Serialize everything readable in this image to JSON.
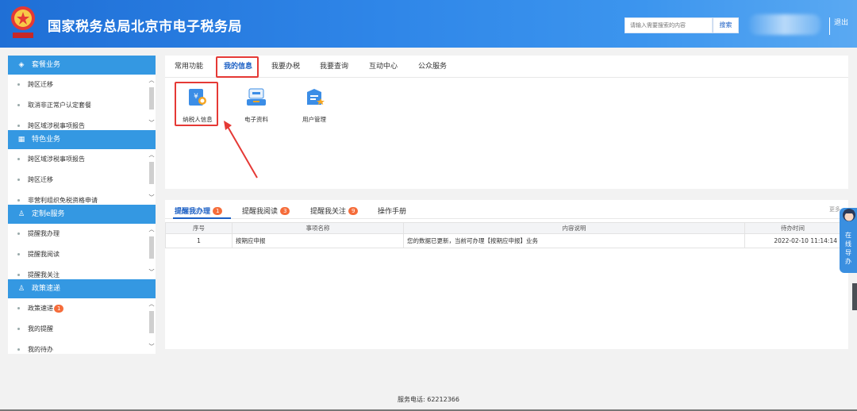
{
  "header": {
    "title": "国家税务总局北京市电子税务局",
    "search_placeholder": "请输入需要搜索的内容",
    "search_button": "搜索",
    "separator": "|",
    "logout": "退出"
  },
  "sidebar": {
    "sections": [
      {
        "title": "套餐业务",
        "icon": "cube-icon",
        "items": [
          "跨区迁移",
          "取消非正常户认定套餐",
          "跨区域涉税事项报告"
        ]
      },
      {
        "title": "特色业务",
        "icon": "grid-icon",
        "items": [
          "跨区域涉税事项报告",
          "跨区迁移",
          "非营利组织免税资格申请"
        ]
      },
      {
        "title": "定制e服务",
        "icon": "user-icon",
        "items": [
          "提醒我办理",
          "提醒我阅读",
          "提醒我关注"
        ]
      },
      {
        "title": "政策速递",
        "icon": "user-icon",
        "items": [
          "政策速递",
          "我的提醒",
          "我的待办"
        ],
        "badge": "1"
      }
    ]
  },
  "tabs": [
    "常用功能",
    "我的信息",
    "我要办税",
    "我要查询",
    "互动中心",
    "公众服务"
  ],
  "active_tab": "我的信息",
  "apps": [
    {
      "label": "纳税人信息",
      "icon": "taxpayer-info-icon"
    },
    {
      "label": "电子资料",
      "icon": "electronic-docs-icon"
    },
    {
      "label": "用户管理",
      "icon": "user-management-icon"
    }
  ],
  "bottom_tabs": [
    {
      "label": "提醒我办理",
      "badge": "1"
    },
    {
      "label": "提醒我阅读",
      "badge": "3"
    },
    {
      "label": "提醒我关注",
      "badge": "9"
    },
    {
      "label": "操作手册",
      "badge": ""
    }
  ],
  "more": "更多",
  "table": {
    "headers": [
      "序号",
      "事项名称",
      "内容说明",
      "待办时间"
    ],
    "rows": [
      [
        "1",
        "按期应申报",
        "您的数据已更新，当前可办理【按期应申报】业务",
        "2022-02-10 11:14:14"
      ]
    ]
  },
  "float_guide": "在线导办",
  "footer": "服务电话: 62212366",
  "colors": {
    "header": "#2f86e8",
    "sidebar_head": "#3498e2",
    "accent": "#1b5fc4",
    "highlight": "#e53935",
    "badge": "#f56c3a"
  }
}
